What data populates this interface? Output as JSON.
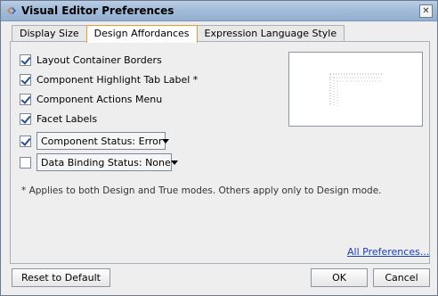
{
  "window": {
    "title": "Visual Editor Preferences",
    "close_glyph": "✕"
  },
  "tabs": [
    {
      "label": "Display Size",
      "active": false
    },
    {
      "label": "Design Affordances",
      "active": true
    },
    {
      "label": "Expression Language Style",
      "active": false
    }
  ],
  "options": [
    {
      "label": "Layout Container Borders",
      "checked": true
    },
    {
      "label": "Component Highlight Tab Label *",
      "checked": true
    },
    {
      "label": "Component Actions Menu",
      "checked": true
    },
    {
      "label": "Facet Labels",
      "checked": true
    }
  ],
  "status_options": [
    {
      "checked": true,
      "selected": "Component Status: Error"
    },
    {
      "checked": false,
      "selected": "Data Binding Status: None"
    }
  ],
  "note": "* Applies to both Design and True modes. Others apply only to Design mode.",
  "all_preferences_link": "All Preferences...",
  "buttons": {
    "reset": "Reset to Default",
    "ok": "OK",
    "cancel": "Cancel"
  },
  "colors": {
    "title_bar": "#a3bcd9",
    "active_tab_border": "#e89a3a",
    "link": "#1a3fb8"
  }
}
